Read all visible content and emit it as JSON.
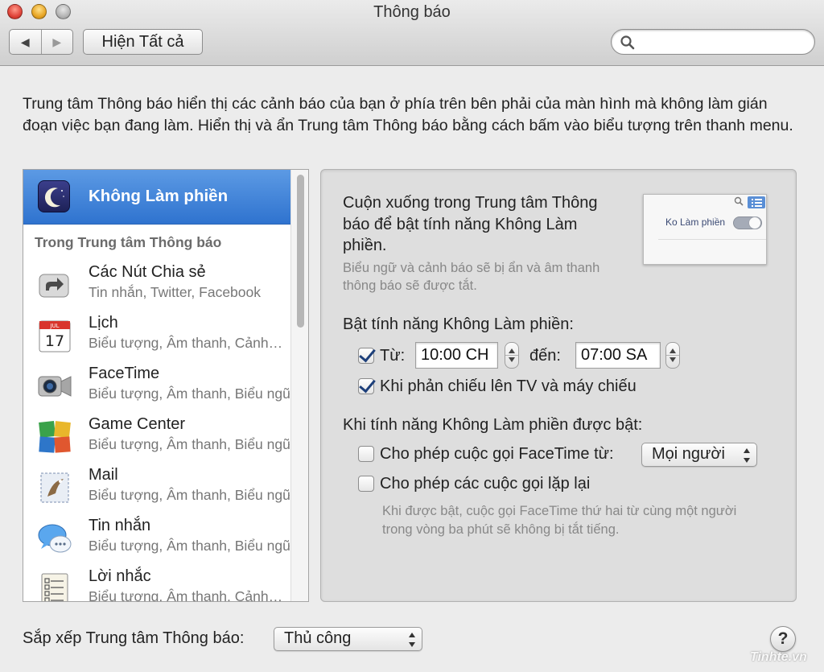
{
  "window": {
    "title": "Thông báo"
  },
  "toolbar": {
    "back_icon": "◀",
    "forward_icon": "▶",
    "show_all_label": "Hiện Tất cả",
    "search_placeholder": ""
  },
  "description": "Trung tâm Thông báo hiển thị các cảnh báo của bạn ở phía trên bên phải của màn hình mà không làm gián đoạn việc bạn đang làm. Hiển thị và ẩn Trung tâm Thông báo bằng cách bấm vào biểu tượng trên thanh menu.",
  "sidebar": {
    "selected_item": {
      "label": "Không Làm phiền",
      "icon": "moon-icon"
    },
    "section_header": "Trong Trung tâm Thông báo",
    "items": [
      {
        "name": "Các Nút Chia sẻ",
        "subtitle": "Tin nhắn, Twitter, Facebook",
        "icon": "share-icon"
      },
      {
        "name": "Lịch",
        "subtitle": "Biểu tượng, Âm thanh, Cảnh…",
        "icon": "calendar-icon",
        "icon_month": "JUL",
        "icon_day": "17"
      },
      {
        "name": "FaceTime",
        "subtitle": "Biểu tượng, Âm thanh, Biểu ngữ",
        "icon": "facetime-icon"
      },
      {
        "name": "Game Center",
        "subtitle": "Biểu tượng, Âm thanh, Biểu ngữ",
        "icon": "game-center-icon"
      },
      {
        "name": "Mail",
        "subtitle": "Biểu tượng, Âm thanh, Biểu ngữ",
        "icon": "mail-icon"
      },
      {
        "name": "Tin nhắn",
        "subtitle": "Biểu tượng, Âm thanh, Biểu ngữ",
        "icon": "messages-icon"
      },
      {
        "name": "Lời nhắc",
        "subtitle": "Biểu tượng, Âm thanh, Cảnh…",
        "icon": "reminders-icon"
      }
    ]
  },
  "dnd": {
    "intro": "Cuộn xuống trong Trung tâm Thông báo để bật tính năng Không Làm phiền.",
    "intro_note": "Biểu ngữ và cảnh báo sẽ bị ẩn và âm thanh thông báo sẽ được tắt.",
    "preview_label": "Ko Làm phiền",
    "preview_toggle_on": true,
    "turn_on_header": "Bật tính năng Không Làm phiền:",
    "from_label": "Từ:",
    "from_checked": true,
    "from_value": "10:00 CH",
    "to_label": "đến:",
    "to_value": "07:00 SA",
    "mirroring_label": "Khi phản chiếu lên TV và máy chiếu",
    "mirroring_checked": true,
    "when_on_header": "Khi tính năng Không Làm phiền được bật:",
    "allow_facetime_label": "Cho phép cuộc gọi FaceTime từ:",
    "allow_facetime_checked": false,
    "allow_facetime_value": "Mọi người",
    "allow_repeat_label": "Cho phép các cuộc gọi lặp lại",
    "allow_repeat_checked": false,
    "repeat_note": "Khi được bật, cuộc gọi FaceTime thứ hai từ cùng một người trong vòng ba phút sẽ không bị tắt tiếng."
  },
  "footer": {
    "sort_label": "Sắp xếp Trung tâm Thông báo:",
    "sort_value": "Thủ công",
    "help_label": "?",
    "watermark": "Tinhte.vn"
  },
  "colors": {
    "selection": "#3a7fd9",
    "panel": "#dedede",
    "window": "#ececec"
  }
}
